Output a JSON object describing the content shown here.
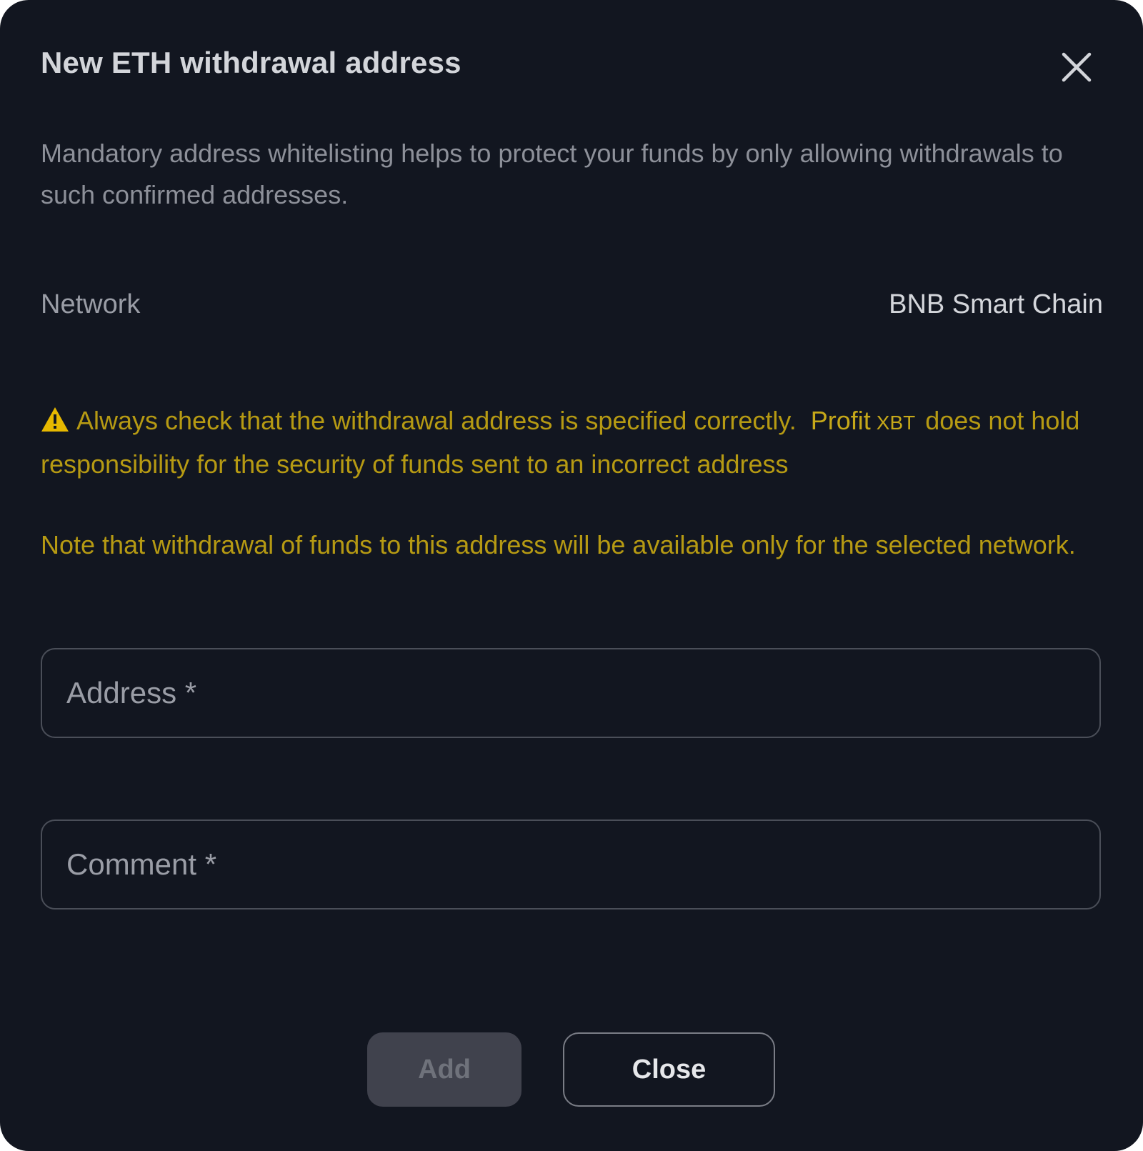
{
  "dialog": {
    "title": "New ETH withdrawal address",
    "close_icon": "close-icon",
    "description": "Mandatory address whitelisting helps to protect your funds by only allowing withdrawals to such confirmed addresses."
  },
  "network": {
    "label": "Network",
    "value": "BNB Smart Chain"
  },
  "warning": {
    "icon": "warning-icon",
    "text_before": "Always check that the withdrawal address is specified correctly.",
    "brand_name": "Profit",
    "brand_suffix": "XBT",
    "text_after": "does not hold responsibility for the security of funds sent to an incorrect address"
  },
  "note": {
    "text": "Note that withdrawal of funds to this address will be available only for the selected network."
  },
  "form": {
    "address": {
      "placeholder": "Address *",
      "value": ""
    },
    "comment": {
      "placeholder": "Comment *",
      "value": ""
    }
  },
  "actions": {
    "add_label": "Add",
    "close_label": "Close"
  },
  "colors": {
    "background": "#121620",
    "warning": "#b69a13",
    "add_button_disabled": "#40424d"
  }
}
